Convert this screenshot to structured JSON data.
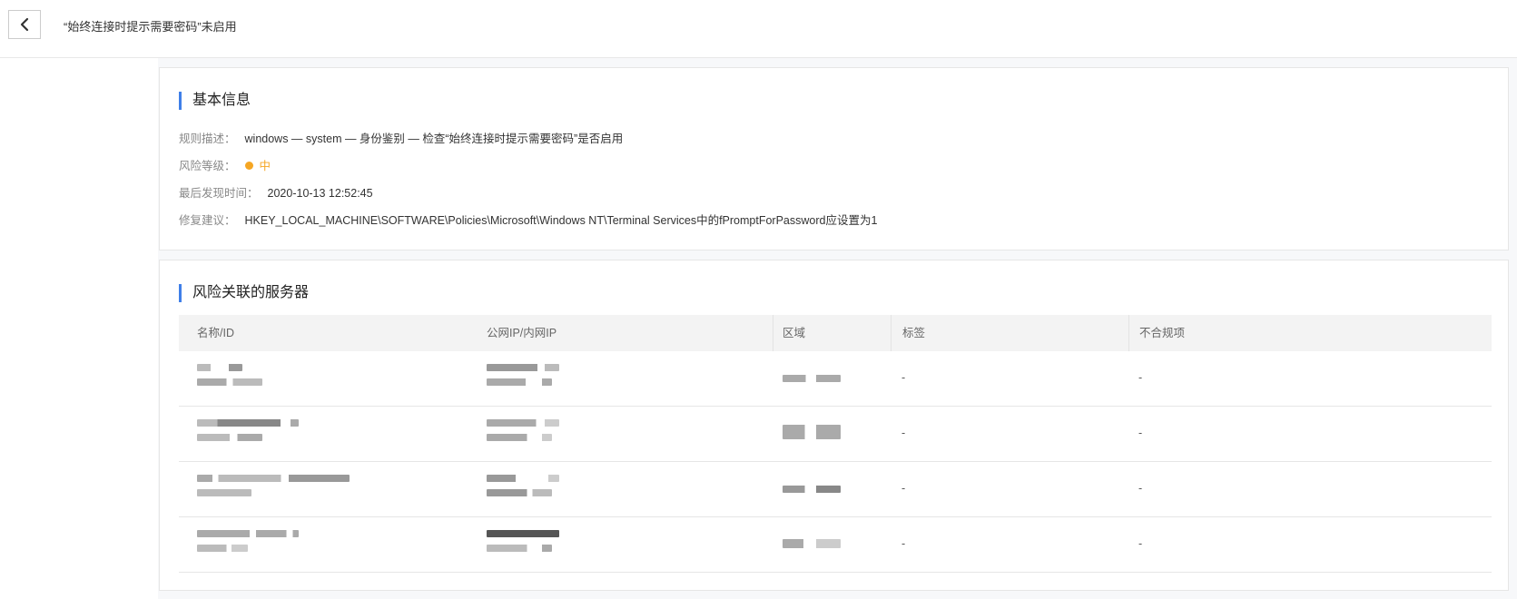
{
  "header": {
    "title": "“始终连接时提示需要密码”未启用",
    "back_icon": "chevron-left-icon"
  },
  "basic_info": {
    "section_title": "基本信息",
    "rule_desc_label": "规则描述：",
    "rule_desc_value": "windows — system — 身份鉴别 — 检查“始终连接时提示需要密码”是否启用",
    "risk_level_label": "风险等级：",
    "risk_level_value": "中",
    "risk_color": "#f5a623",
    "last_found_label": "最后发现时间：",
    "last_found_value": "2020-10-13 12:52:45",
    "fix_label": "修复建议：",
    "fix_value": "HKEY_LOCAL_MACHINE\\SOFTWARE\\Policies\\Microsoft\\Windows NT\\Terminal Services中的fPromptForPassword应设置为1"
  },
  "servers": {
    "section_title": "风险关联的服务器",
    "columns": [
      "名称/ID",
      "公网IP/内网IP",
      "区域",
      "标签",
      "不合规项"
    ],
    "rows": [
      {
        "tag": "-",
        "noncompliant": "-"
      },
      {
        "tag": "-",
        "noncompliant": "-"
      },
      {
        "tag": "-",
        "noncompliant": "-"
      },
      {
        "tag": "-",
        "noncompliant": "-"
      }
    ]
  },
  "accent_color": "#3f7fe8"
}
